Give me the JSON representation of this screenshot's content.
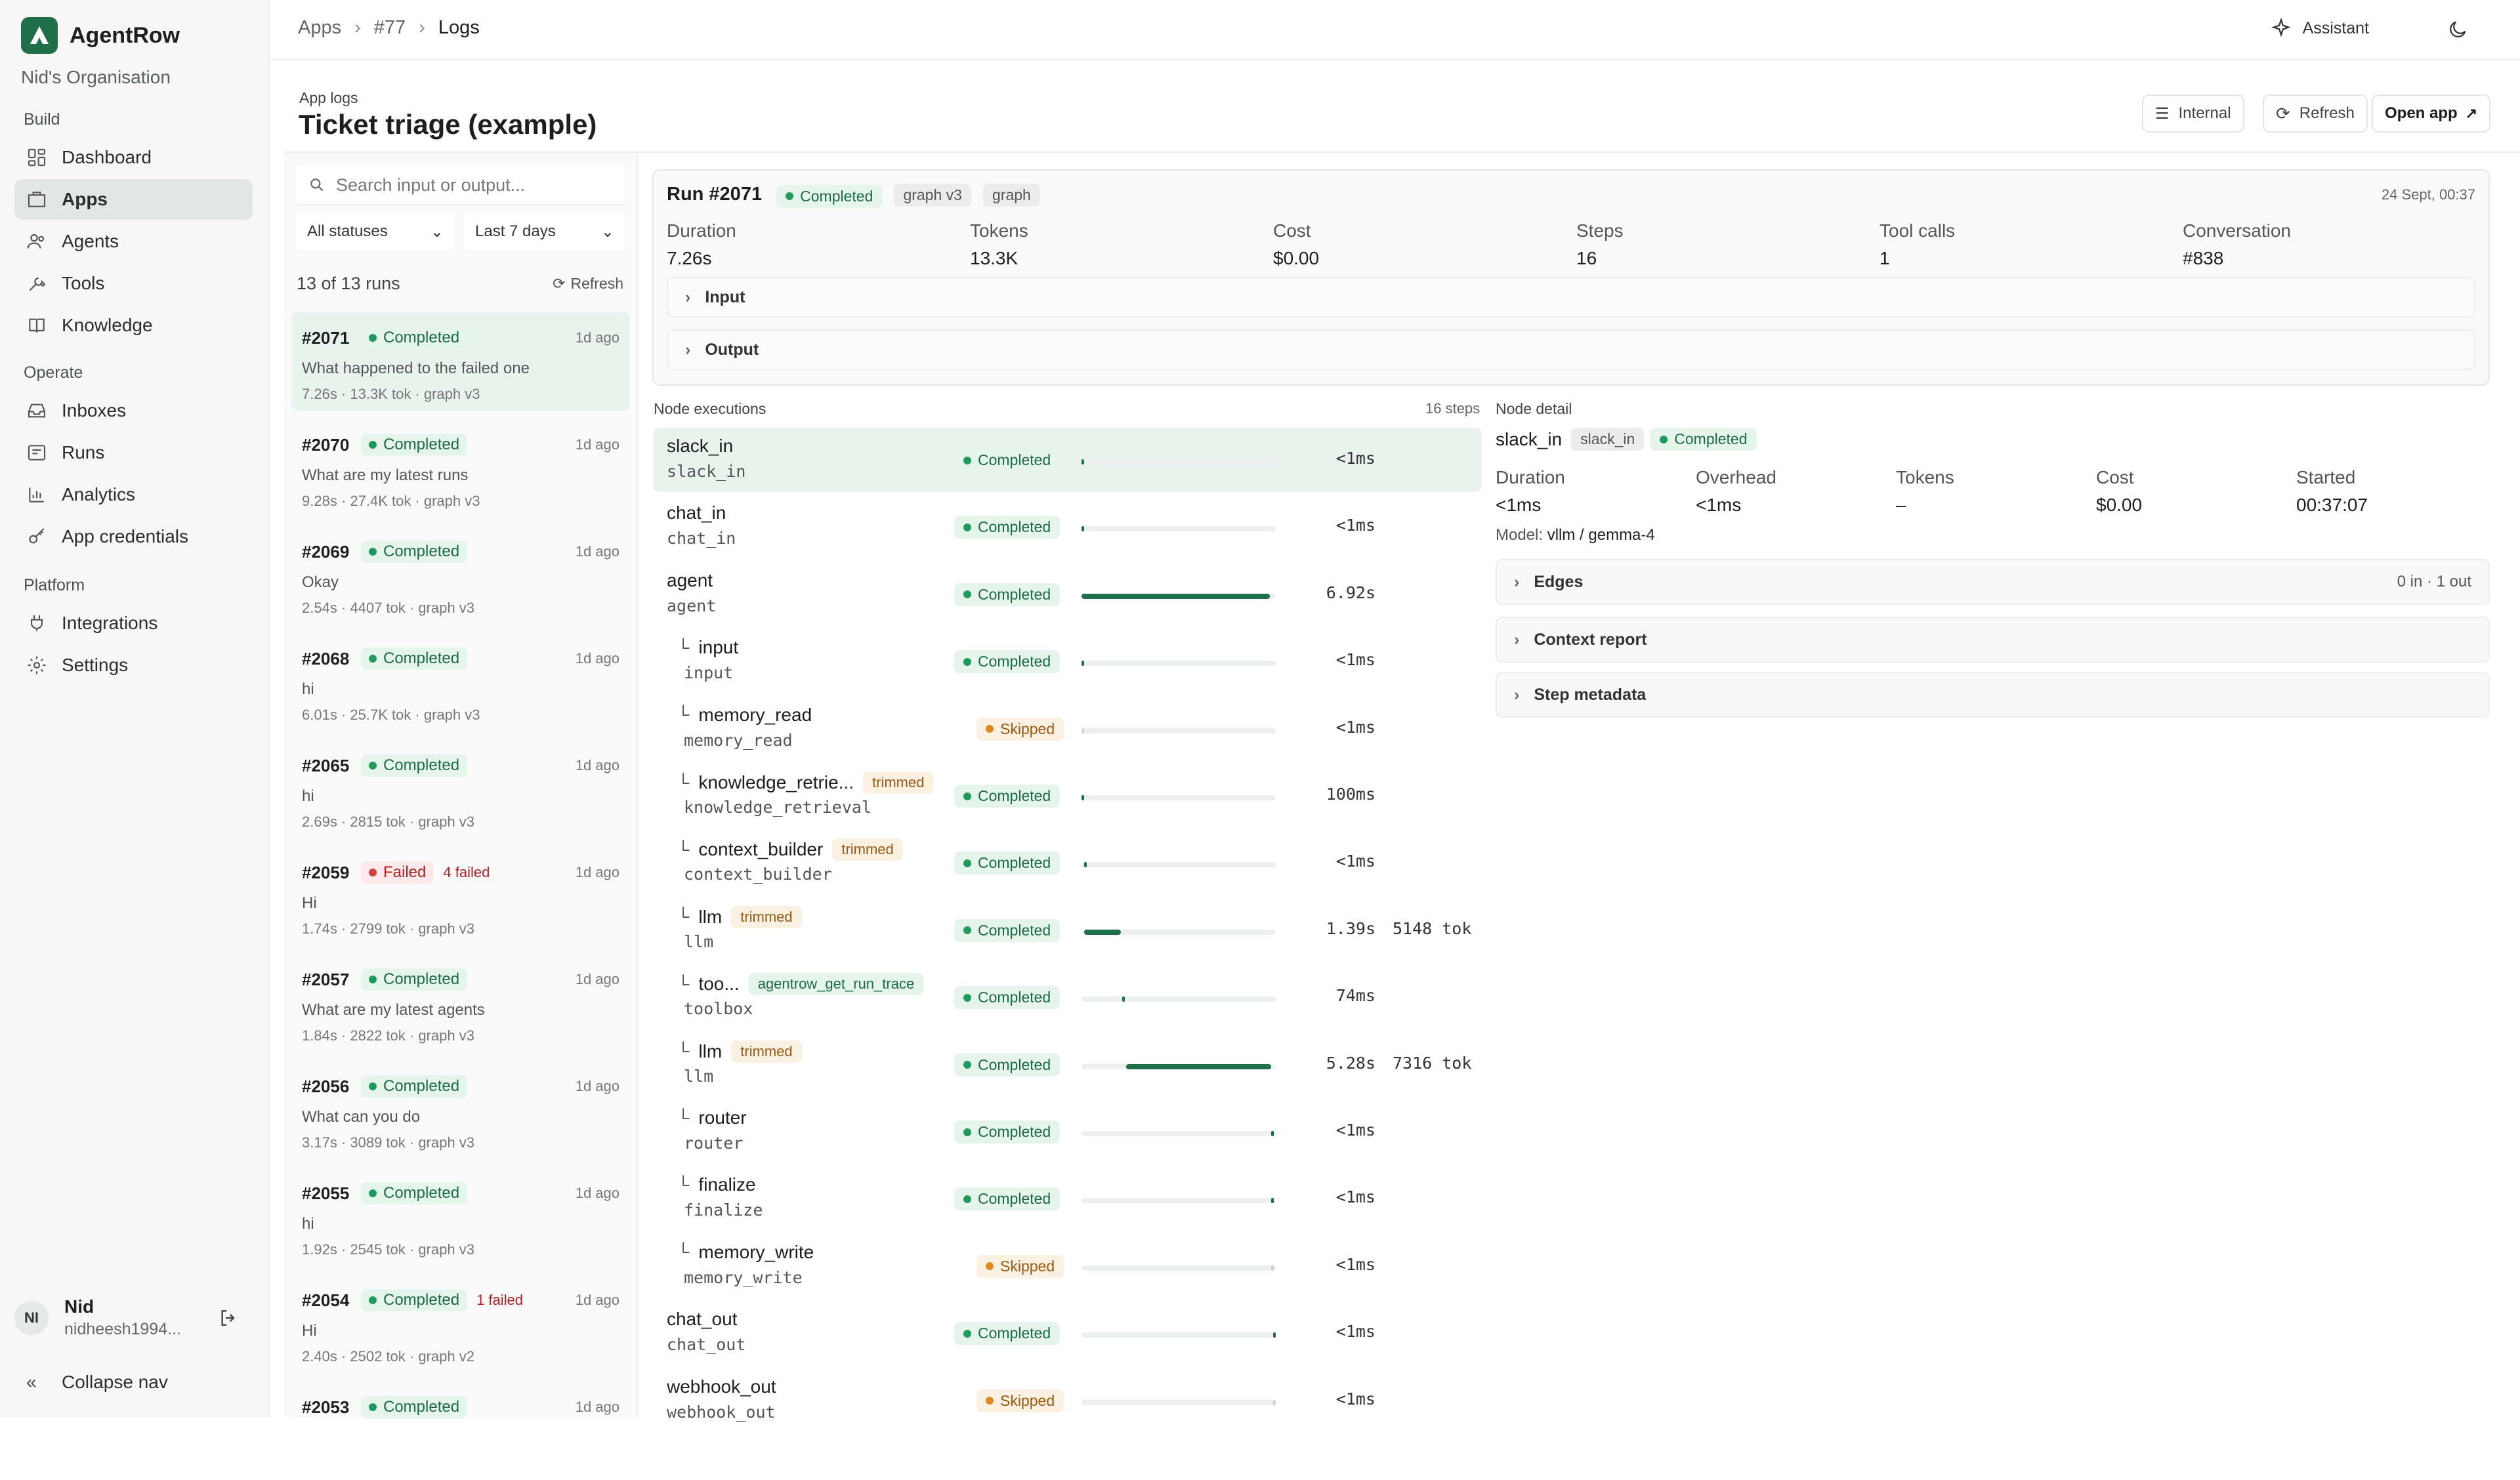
{
  "sidebar": {
    "brand": "AgentRow",
    "org": "Nid's Organisation",
    "sections": {
      "build": "Build",
      "operate": "Operate",
      "platform": "Platform"
    },
    "items": [
      {
        "label": "Dashboard",
        "icon": "dashboard-icon"
      },
      {
        "label": "Apps",
        "icon": "apps-icon"
      },
      {
        "label": "Agents",
        "icon": "agents-icon"
      },
      {
        "label": "Tools",
        "icon": "tools-icon"
      },
      {
        "label": "Knowledge",
        "icon": "book-icon"
      },
      {
        "label": "Inboxes",
        "icon": "inbox-icon"
      },
      {
        "label": "Runs",
        "icon": "runs-icon"
      },
      {
        "label": "Analytics",
        "icon": "chart-icon"
      },
      {
        "label": "App credentials",
        "icon": "key-icon"
      },
      {
        "label": "Integrations",
        "icon": "plug-icon"
      },
      {
        "label": "Settings",
        "icon": "gear-icon"
      }
    ],
    "user": {
      "initials": "NI",
      "name": "Nid",
      "email": "nidheesh1994..."
    },
    "collapse": "Collapse nav"
  },
  "topbar": {
    "breadcrumbs": [
      "Apps",
      "#77",
      "Logs"
    ],
    "assistant": "Assistant"
  },
  "header": {
    "subtitle": "App logs",
    "title": "Ticket triage (example)",
    "buttons": {
      "internal": "Internal",
      "refresh": "Refresh",
      "open": "Open app"
    }
  },
  "runs": {
    "search_placeholder": "Search input or output...",
    "status_filter": "All statuses",
    "time_filter": "Last 7 days",
    "count": "13 of 13 runs",
    "refresh": "Refresh",
    "items": [
      {
        "id": "#2071",
        "status": "Completed",
        "failed": "",
        "ago": "1d ago",
        "query": "What happened to the failed one",
        "meta": "7.26s · 13.3K tok · graph v3"
      },
      {
        "id": "#2070",
        "status": "Completed",
        "failed": "",
        "ago": "1d ago",
        "query": "What are my latest runs",
        "meta": "9.28s · 27.4K tok · graph v3"
      },
      {
        "id": "#2069",
        "status": "Completed",
        "failed": "",
        "ago": "1d ago",
        "query": "Okay",
        "meta": "2.54s · 4407 tok · graph v3"
      },
      {
        "id": "#2068",
        "status": "Completed",
        "failed": "",
        "ago": "1d ago",
        "query": "hi",
        "meta": "6.01s · 25.7K tok · graph v3"
      },
      {
        "id": "#2065",
        "status": "Completed",
        "failed": "",
        "ago": "1d ago",
        "query": "hi",
        "meta": "2.69s · 2815 tok · graph v3"
      },
      {
        "id": "#2059",
        "status": "Failed",
        "failed": "4 failed",
        "ago": "1d ago",
        "query": "Hi",
        "meta": "1.74s · 2799 tok · graph v3"
      },
      {
        "id": "#2057",
        "status": "Completed",
        "failed": "",
        "ago": "1d ago",
        "query": "What are my latest agents",
        "meta": "1.84s · 2822 tok · graph v3"
      },
      {
        "id": "#2056",
        "status": "Completed",
        "failed": "",
        "ago": "1d ago",
        "query": "What can you do",
        "meta": "3.17s · 3089 tok · graph v3"
      },
      {
        "id": "#2055",
        "status": "Completed",
        "failed": "",
        "ago": "1d ago",
        "query": "hi",
        "meta": "1.92s · 2545 tok · graph v3"
      },
      {
        "id": "#2054",
        "status": "Completed",
        "failed": "1 failed",
        "ago": "1d ago",
        "query": "Hi",
        "meta": "2.40s · 2502 tok · graph v2"
      },
      {
        "id": "#2053",
        "status": "Completed",
        "failed": "",
        "ago": "1d ago",
        "query": "",
        "meta": ""
      }
    ]
  },
  "run": {
    "title": "Run #2071",
    "status": "Completed",
    "tags": [
      "graph v3",
      "graph"
    ],
    "date": "24 Sept, 00:37",
    "metrics": [
      {
        "label": "Duration",
        "value": "7.26s"
      },
      {
        "label": "Tokens",
        "value": "13.3K"
      },
      {
        "label": "Cost",
        "value": "$0.00"
      },
      {
        "label": "Steps",
        "value": "16"
      },
      {
        "label": "Tool calls",
        "value": "1"
      },
      {
        "label": "Conversation",
        "value": "#838"
      }
    ],
    "sections": {
      "input": "Input",
      "output": "Output"
    }
  },
  "nodes": {
    "title": "Node executions",
    "steps": "16 steps",
    "items": [
      {
        "name": "slack_in",
        "sub": "slack_in",
        "child": false,
        "tag": "",
        "status": "Completed",
        "start": 0,
        "width": 0.01,
        "dur": "<1ms",
        "tok": ""
      },
      {
        "name": "chat_in",
        "sub": "chat_in",
        "child": false,
        "tag": "",
        "status": "Completed",
        "start": 0,
        "width": 0.01,
        "dur": "<1ms",
        "tok": ""
      },
      {
        "name": "agent",
        "sub": "agent",
        "child": false,
        "tag": "",
        "status": "Completed",
        "start": 0,
        "width": 0.97,
        "dur": "6.92s",
        "tok": ""
      },
      {
        "name": "input",
        "sub": "input",
        "child": true,
        "tag": "",
        "status": "Completed",
        "start": 0,
        "width": 0.01,
        "dur": "<1ms",
        "tok": ""
      },
      {
        "name": "memory_read",
        "sub": "memory_read",
        "child": true,
        "tag": "",
        "status": "Skipped",
        "start": 0,
        "width": 0.01,
        "dur": "<1ms",
        "tok": ""
      },
      {
        "name": "knowledge_retrie...",
        "sub": "knowledge_retrieval",
        "child": true,
        "tag": "trimmed",
        "status": "Completed",
        "start": 0,
        "width": 0.015,
        "dur": "100ms",
        "tok": ""
      },
      {
        "name": "context_builder",
        "sub": "context_builder",
        "child": true,
        "tag": "trimmed",
        "status": "Completed",
        "start": 0.015,
        "width": 0.01,
        "dur": "<1ms",
        "tok": ""
      },
      {
        "name": "llm",
        "sub": "llm",
        "child": true,
        "tag": "trimmed",
        "status": "Completed",
        "start": 0.015,
        "width": 0.19,
        "dur": "1.39s",
        "tok": "5148 tok"
      },
      {
        "name": "too...",
        "sub": "toolbox",
        "child": true,
        "tag": "agentrow_get_run_trace",
        "status": "Completed",
        "start": 0.21,
        "width": 0.012,
        "dur": "74ms",
        "tok": ""
      },
      {
        "name": "llm",
        "sub": "llm",
        "child": true,
        "tag": "trimmed",
        "status": "Completed",
        "start": 0.23,
        "width": 0.745,
        "dur": "5.28s",
        "tok": "7316 tok"
      },
      {
        "name": "router",
        "sub": "router",
        "child": true,
        "tag": "",
        "status": "Completed",
        "start": 0.975,
        "width": 0.01,
        "dur": "<1ms",
        "tok": ""
      },
      {
        "name": "finalize",
        "sub": "finalize",
        "child": true,
        "tag": "",
        "status": "Completed",
        "start": 0.975,
        "width": 0.01,
        "dur": "<1ms",
        "tok": ""
      },
      {
        "name": "memory_write",
        "sub": "memory_write",
        "child": true,
        "tag": "",
        "status": "Skipped",
        "start": 0.975,
        "width": 0.01,
        "dur": "<1ms",
        "tok": ""
      },
      {
        "name": "chat_out",
        "sub": "chat_out",
        "child": false,
        "tag": "",
        "status": "Completed",
        "start": 0.985,
        "width": 0.01,
        "dur": "<1ms",
        "tok": ""
      },
      {
        "name": "webhook_out",
        "sub": "webhook_out",
        "child": false,
        "tag": "",
        "status": "Skipped",
        "start": 0.985,
        "width": 0.01,
        "dur": "<1ms",
        "tok": ""
      }
    ]
  },
  "detail": {
    "title": "Node detail",
    "name": "slack_in",
    "type": "slack_in",
    "status": "Completed",
    "metrics": [
      {
        "label": "Duration",
        "value": "<1ms"
      },
      {
        "label": "Overhead",
        "value": "<1ms"
      },
      {
        "label": "Tokens",
        "value": "–"
      },
      {
        "label": "Cost",
        "value": "$0.00"
      },
      {
        "label": "Started",
        "value": "00:37:07"
      }
    ],
    "model_label": "Model:",
    "model": "vllm / gemma-4",
    "sections": {
      "edges": "Edges",
      "edges_count": "0 in · 1 out",
      "context": "Context report",
      "metadata": "Step metadata"
    }
  }
}
